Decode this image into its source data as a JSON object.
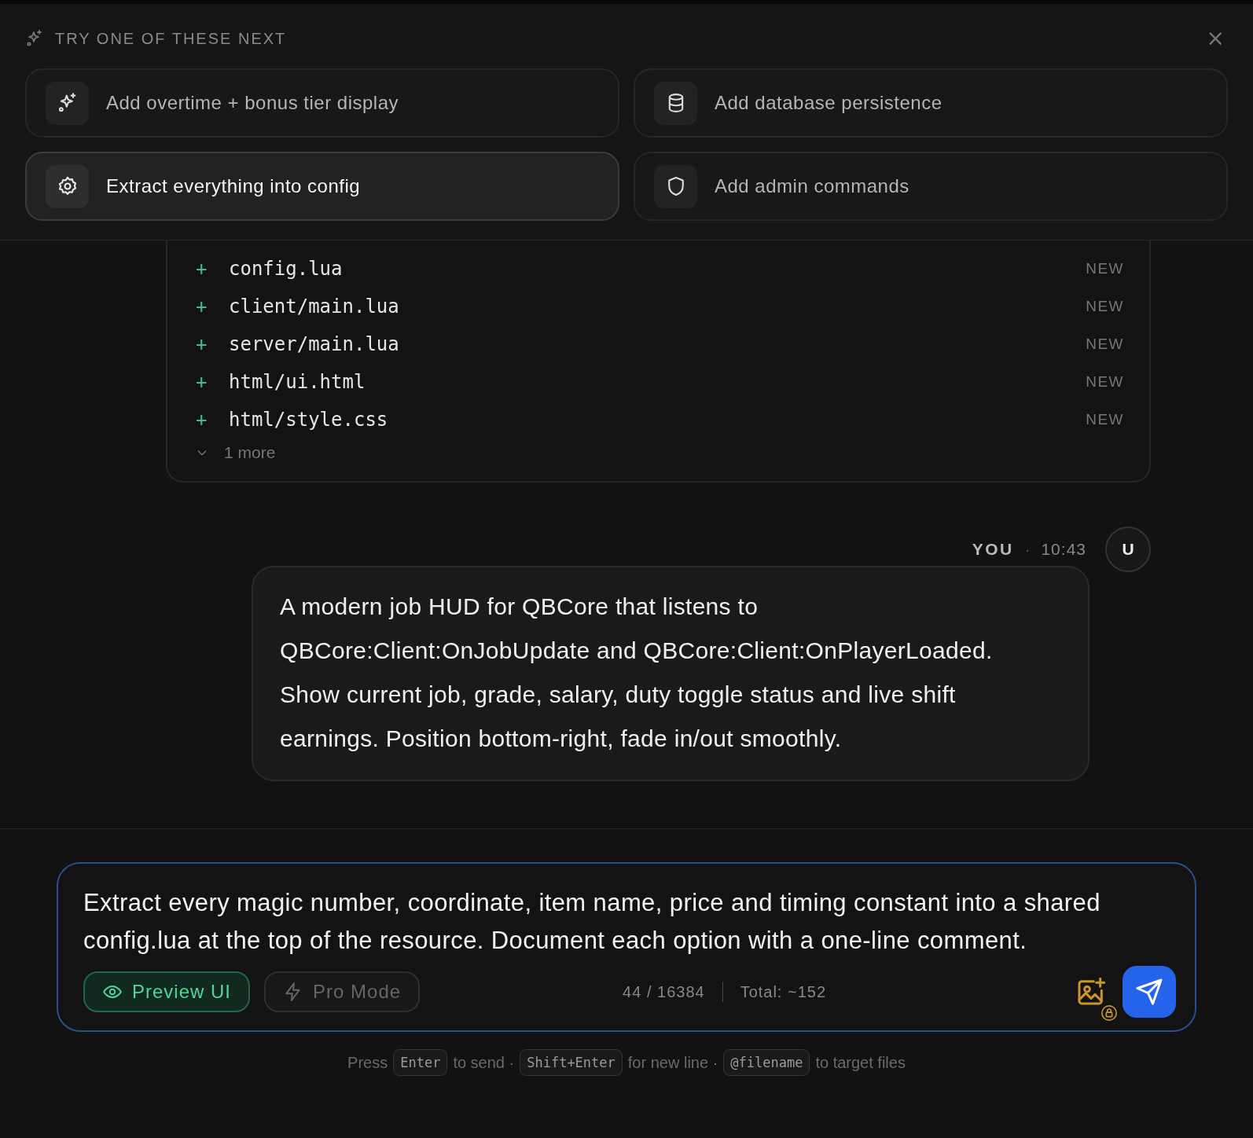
{
  "suggestions": {
    "title": "TRY ONE OF THESE NEXT",
    "close": "×",
    "items": [
      {
        "label": "Add overtime + bonus tier display",
        "kind": "sparkle",
        "selected": false
      },
      {
        "label": "Add database persistence",
        "kind": "database",
        "selected": false
      },
      {
        "label": "Extract everything into config",
        "kind": "gear",
        "selected": true
      },
      {
        "label": "Add admin commands",
        "kind": "shield",
        "selected": false
      }
    ]
  },
  "files": {
    "items": [
      {
        "mark": "+",
        "name": "config.lua",
        "status": "NEW"
      },
      {
        "mark": "+",
        "name": "client/main.lua",
        "status": "NEW"
      },
      {
        "mark": "+",
        "name": "server/main.lua",
        "status": "NEW"
      },
      {
        "mark": "+",
        "name": "html/ui.html",
        "status": "NEW"
      },
      {
        "mark": "+",
        "name": "html/style.css",
        "status": "NEW"
      }
    ],
    "more": "1 more"
  },
  "message": {
    "author": "YOU",
    "separator": "·",
    "time": "10:43",
    "avatar": "U",
    "text": "A modern job HUD for QBCore that listens to QBCore:Client:OnJobUpdate and QBCore:Client:OnPlayerLoaded. Show current job, grade, salary, duty toggle status and live shift earnings. Position bottom-right, fade in/out smoothly."
  },
  "composer": {
    "value": "Extract every magic number, coordinate, item name, price and timing constant into a shared config.lua at the top of the resource. Document each option with a one-line comment.",
    "buttons": [
      {
        "label": "Preview UI",
        "kind": "preview",
        "on": true
      },
      {
        "label": "Pro Mode",
        "kind": "pro",
        "on": false
      }
    ],
    "count": "44 / 16384",
    "total": "Total: ~152"
  },
  "hint": [
    {
      "kind": "text",
      "text": "Press"
    },
    {
      "kind": "key",
      "text": "Enter"
    },
    {
      "kind": "text",
      "text": "to send ·"
    },
    {
      "kind": "key",
      "text": "Shift+Enter"
    },
    {
      "kind": "text",
      "text": "for new line ·"
    },
    {
      "kind": "key",
      "text": "@filename"
    },
    {
      "kind": "text",
      "text": "to target files"
    }
  ]
}
